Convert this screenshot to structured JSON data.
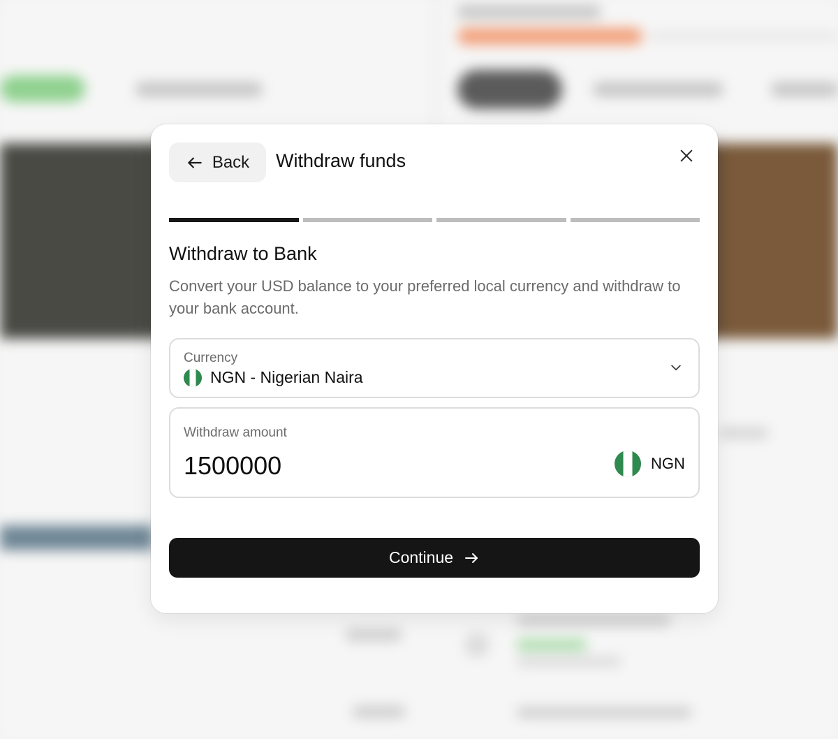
{
  "modal": {
    "back_label": "Back",
    "title": "Withdraw funds",
    "steps": {
      "total": 4,
      "current": 1
    },
    "section_title": "Withdraw to Bank",
    "description": "Convert your USD balance to your preferred local currency and withdraw to your bank account.",
    "currency_field": {
      "label": "Currency",
      "value": "NGN - Nigerian Naira",
      "flag": "nigeria-flag-icon"
    },
    "amount_field": {
      "label": "Withdraw amount",
      "value": "1500000",
      "currency_code": "NGN",
      "flag": "nigeria-flag-icon"
    },
    "continue_label": "Continue"
  },
  "colors": {
    "primary_button": "#151515",
    "step_active": "#171717",
    "step_inactive": "#bdbdbd",
    "flag_green": "#2f8a4f"
  }
}
